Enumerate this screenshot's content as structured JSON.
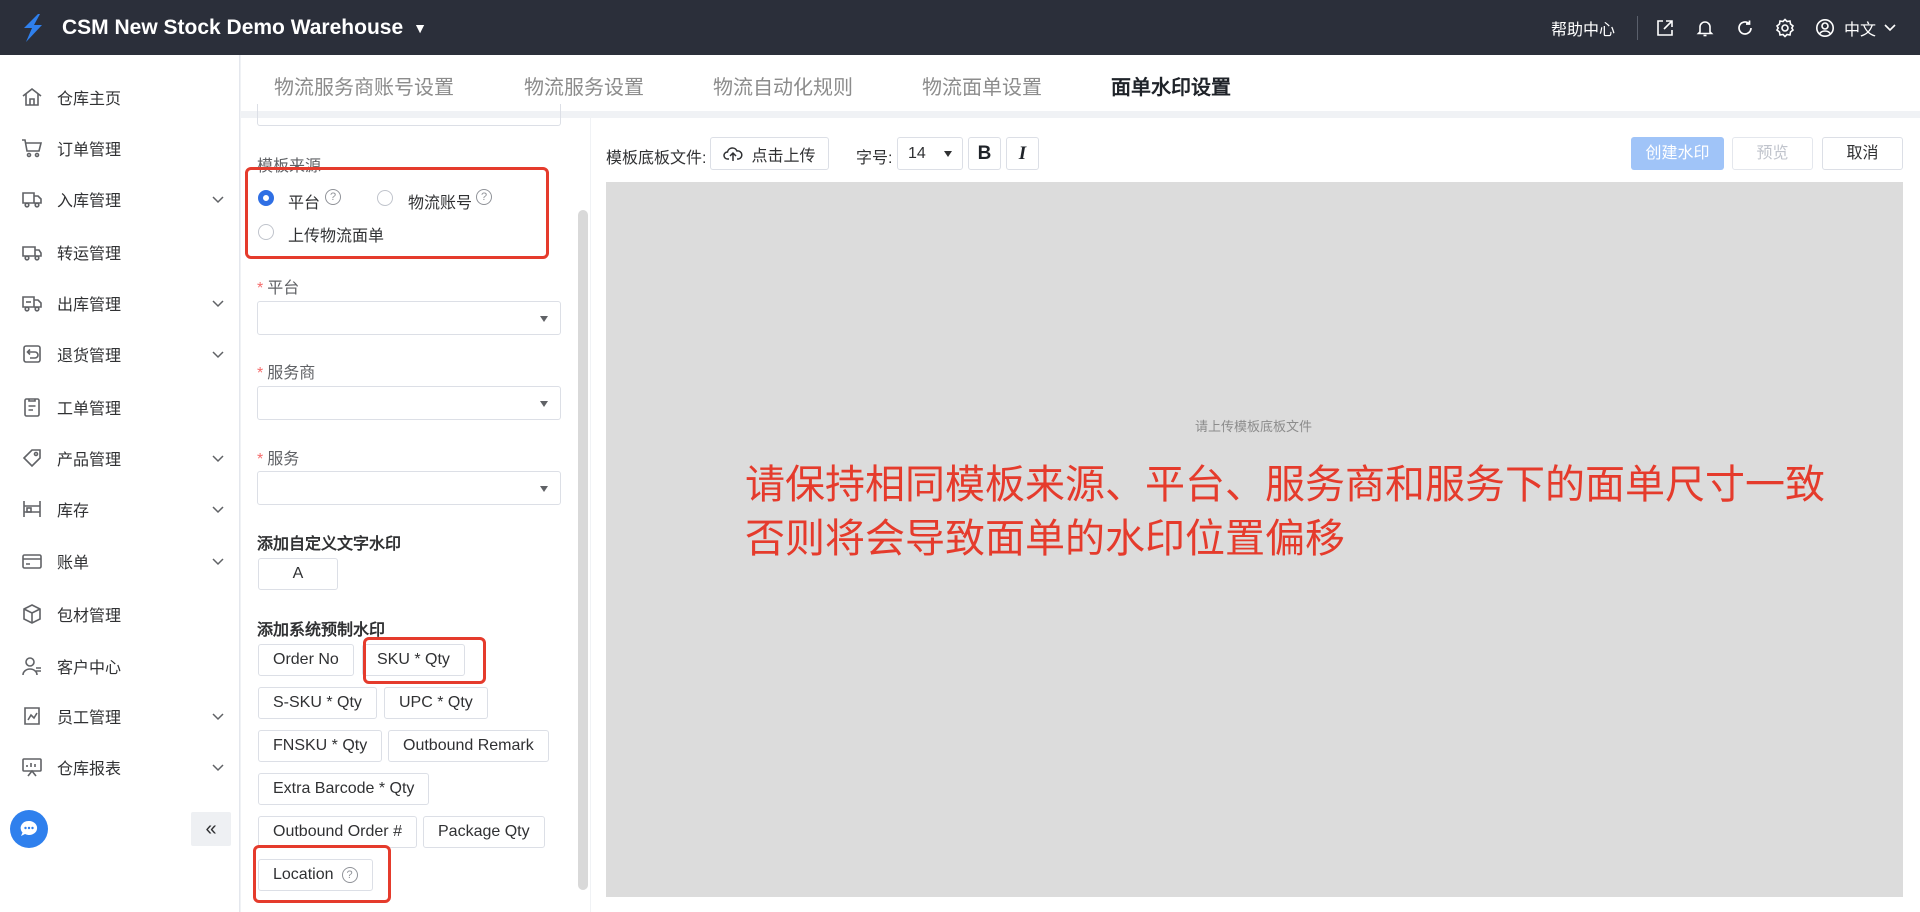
{
  "header": {
    "brand": "CSM New Stock Demo Warehouse",
    "help": "帮助中心",
    "language": "中文",
    "icons": [
      "export-icon",
      "bell-icon",
      "refresh-icon",
      "gear-icon",
      "user-circle-icon"
    ]
  },
  "sidebar": {
    "items": [
      {
        "label": "仓库主页",
        "icon": "home-icon",
        "expandable": false
      },
      {
        "label": "订单管理",
        "icon": "cart-icon",
        "expandable": false
      },
      {
        "label": "入库管理",
        "icon": "truck-in-icon",
        "expandable": true
      },
      {
        "label": "转运管理",
        "icon": "truck-icon",
        "expandable": false
      },
      {
        "label": "出库管理",
        "icon": "truck-out-icon",
        "expandable": true
      },
      {
        "label": "退货管理",
        "icon": "return-icon",
        "expandable": true
      },
      {
        "label": "工单管理",
        "icon": "clipboard-icon",
        "expandable": false
      },
      {
        "label": "产品管理",
        "icon": "tag-icon",
        "expandable": true
      },
      {
        "label": "库存",
        "icon": "shelf-icon",
        "expandable": true
      },
      {
        "label": "账单",
        "icon": "card-icon",
        "expandable": true
      },
      {
        "label": "包材管理",
        "icon": "box-icon",
        "expandable": false
      },
      {
        "label": "客户中心",
        "icon": "customer-icon",
        "expandable": false
      },
      {
        "label": "员工管理",
        "icon": "staff-icon",
        "expandable": true
      },
      {
        "label": "仓库报表",
        "icon": "report-icon",
        "expandable": true
      }
    ],
    "collapse": "«"
  },
  "tabs": [
    {
      "label": "物流服务商账号设置",
      "active": false
    },
    {
      "label": "物流服务设置",
      "active": false
    },
    {
      "label": "物流自动化规则",
      "active": false
    },
    {
      "label": "物流面单设置",
      "active": false
    },
    {
      "label": "面单水印设置",
      "active": true
    }
  ],
  "form": {
    "template_source_label": "模板来源",
    "radio_platform": "平台",
    "radio_account": "物流账号",
    "radio_upload": "上传物流面单",
    "selected_source": "平台",
    "required_mark": "*",
    "platform_label": "平台",
    "carrier_label": "服务商",
    "service_label": "服务",
    "custom_text_label": "添加自定义文字水印",
    "custom_text_button": "A",
    "preset_label": "添加系统预制水印",
    "preset_chips": [
      "Order No",
      "SKU * Qty",
      "S-SKU * Qty",
      "UPC * Qty",
      "FNSKU * Qty",
      "Outbound Remark",
      "Extra Barcode * Qty",
      "Outbound Order #",
      "Package Qty",
      "Location"
    ]
  },
  "editor": {
    "template_file_label": "模板底板文件:",
    "upload_button": "点击上传",
    "font_size_label": "字号:",
    "font_size_value": "14",
    "bold_button": "B",
    "italic_button": "I",
    "create_button": "创建水印",
    "preview_button": "预览",
    "cancel_button": "取消",
    "canvas_hint": "请上传模板底板文件",
    "notice_line1": "请保持相同模板来源、平台、服务商和服务下的面单尺寸一致",
    "notice_line2": "否则将会导致面单的水印位置偏移"
  },
  "colors": {
    "topbar": "#2b2f3a",
    "accent": "#2f6fe4",
    "highlight_red": "#e53b2c",
    "primary_disabled": "#a0c4f8",
    "canvas": "#dcdcdc"
  }
}
